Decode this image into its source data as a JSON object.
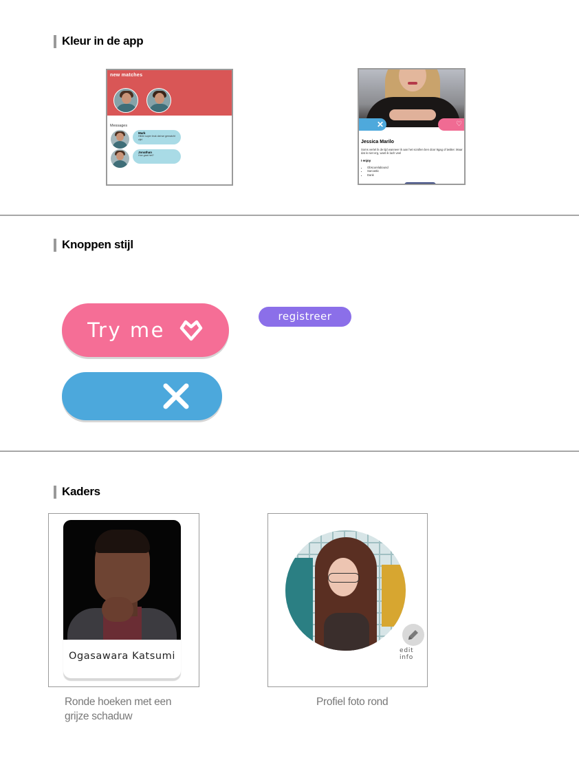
{
  "sections": {
    "color": {
      "title": "Kleur in de app"
    },
    "buttons": {
      "title": "Knoppen stijl"
    },
    "frames": {
      "title": "Kaders"
    }
  },
  "mock_matches": {
    "title": "new matches",
    "messages_label": "Messages",
    "messages": [
      {
        "name": "Mark",
        "text": "Hihihi super leuk dat we gematcht zijn!"
      },
      {
        "name": "Jonathan",
        "text": "Hoe gaat het?"
      }
    ]
  },
  "mock_profile": {
    "close_glyph": "✕",
    "like_glyph": "♡",
    "name": "Jessica Marilo",
    "bio": "Soms vertel ik de tijd wanneer ik aan het scrollen ben door 9gag of twitter. Maar dat is niet erg, want ik lach veel",
    "enjoy_label": "I enjoy",
    "interests": [
      "Obscurelabound",
      "Sarcastic",
      "Dank"
    ]
  },
  "buttons": {
    "try_me_label": "Try me",
    "register_label": "registreer",
    "colors": {
      "pink": "#f56e96",
      "blue": "#4ca8dc",
      "purple": "#8b6fe9"
    }
  },
  "frames": {
    "card_name": "Ogasawara Katsumi",
    "card_caption": [
      "Ronde hoeken met een",
      "grijze schaduw"
    ],
    "edit_label": "edit info",
    "round_caption": "Profiel foto rond"
  },
  "icons": [
    "heart-diamond-icon",
    "close-x-icon",
    "pencil-icon"
  ]
}
